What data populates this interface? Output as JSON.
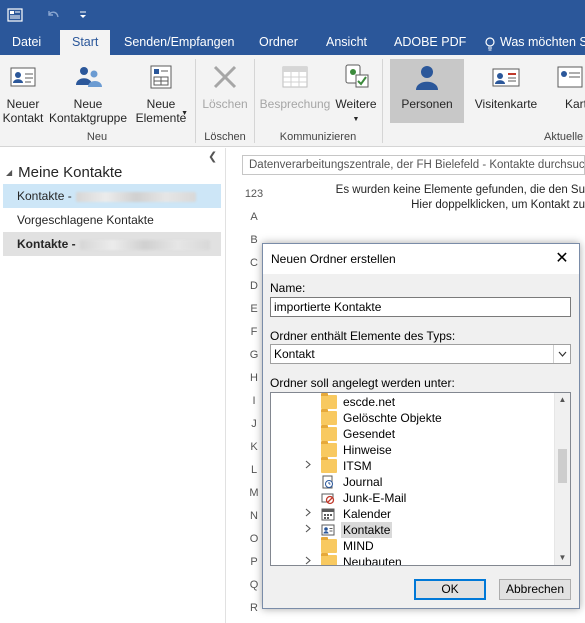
{
  "ribbon_tabs": [
    {
      "label": "Datei"
    },
    {
      "label": "Start"
    },
    {
      "label": "Senden/Empfangen"
    },
    {
      "label": "Ordner"
    },
    {
      "label": "Ansicht"
    },
    {
      "label": "ADOBE PDF"
    },
    {
      "label": "Was möchten S"
    }
  ],
  "ribbon": {
    "neu": {
      "new_contact": "Neuer\nKontakt",
      "new_group": "Neue\nKontaktgruppe",
      "new_items": "Neue\nElemente",
      "group_label": "Neu"
    },
    "loeschen": {
      "delete": "Löschen",
      "group_label": "Löschen"
    },
    "kommunizieren": {
      "meeting": "Besprechung",
      "more": "Weitere",
      "group_label": "Kommunizieren"
    },
    "ansicht": {
      "people": "Personen",
      "business_card": "Visitenkarte",
      "card": "Kart",
      "group_label": "Aktuelle"
    }
  },
  "nav": {
    "header": "Meine Kontakte",
    "items": [
      {
        "label": "Kontakte -"
      },
      {
        "label": "Vorgeschlagene Kontakte"
      },
      {
        "label": "Kontakte -"
      }
    ]
  },
  "search": {
    "placeholder": "Datenverarbeitungszentrale, der FH Bielefeld - Kontakte durchsuc"
  },
  "letters": [
    "123",
    "A",
    "B",
    "C",
    "D",
    "E",
    "F",
    "G",
    "H",
    "I",
    "J",
    "K",
    "L",
    "M",
    "N",
    "O",
    "P",
    "Q",
    "R"
  ],
  "empty_message": {
    "line1": "Es wurden keine Elemente gefunden, die den Su",
    "line2": "Hier doppelklicken, um Kontakt zu"
  },
  "dialog": {
    "title": "Neuen Ordner erstellen",
    "name_label": "Name:",
    "name_value": "importierte Kontakte",
    "type_label": "Ordner enthält Elemente des Typs:",
    "type_value": "Kontakt",
    "location_label": "Ordner soll angelegt werden unter:",
    "tree": [
      {
        "label": "escde.net",
        "icon": "folder-icon",
        "expander": ""
      },
      {
        "label": "Gelöschte Objekte",
        "icon": "folder-icon",
        "expander": ""
      },
      {
        "label": "Gesendet",
        "icon": "folder-icon",
        "expander": ""
      },
      {
        "label": "Hinweise",
        "icon": "folder-icon",
        "expander": ""
      },
      {
        "label": "ITSM",
        "icon": "folder-icon",
        "expander": ">"
      },
      {
        "label": "Journal",
        "icon": "journal-icon",
        "expander": ""
      },
      {
        "label": "Junk-E-Mail",
        "icon": "junk-icon",
        "expander": ""
      },
      {
        "label": "Kalender",
        "icon": "calendar-icon",
        "expander": ">"
      },
      {
        "label": "Kontakte",
        "icon": "contacts-icon",
        "expander": ">",
        "selected": true
      },
      {
        "label": "MIND",
        "icon": "folder-icon",
        "expander": ""
      },
      {
        "label": "Neubauten",
        "icon": "folder-icon",
        "expander": ">"
      }
    ],
    "ok": "OK",
    "cancel": "Abbrechen"
  },
  "colors": {
    "accent": "#2b579a",
    "selection": "#cde6f7"
  }
}
